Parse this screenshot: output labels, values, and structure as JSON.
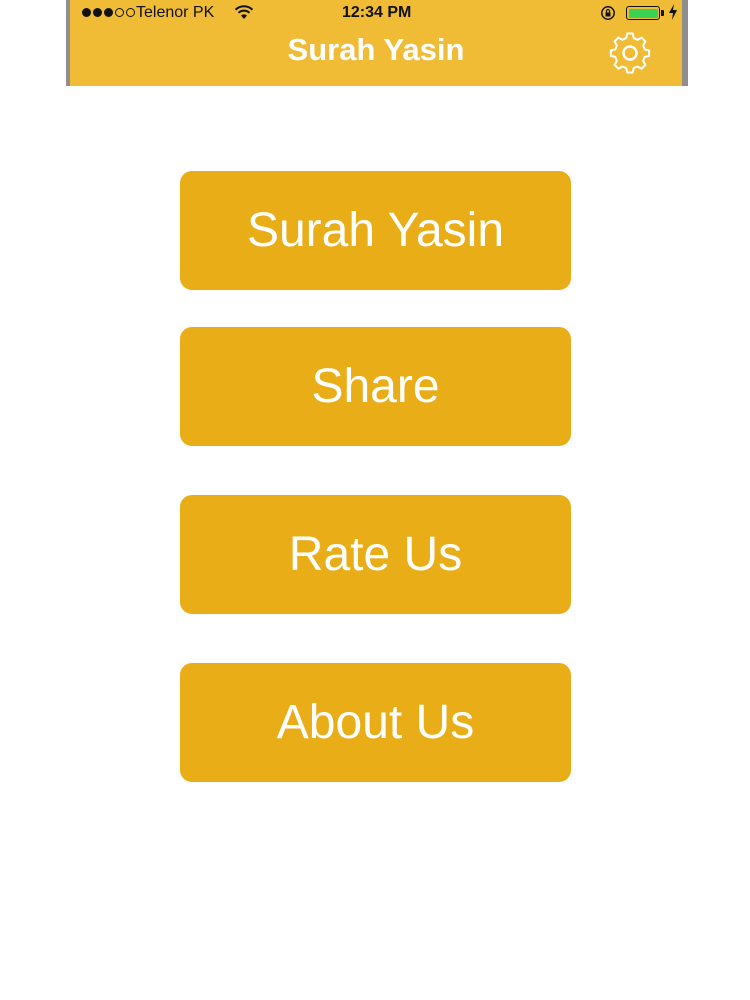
{
  "status_bar": {
    "carrier": "Telenor PK",
    "time": "12:34 PM",
    "signal_bars_filled": 3,
    "signal_bars_total": 5,
    "battery_level": 1.0
  },
  "nav": {
    "title": "Surah Yasin",
    "settings_icon": "gear-icon"
  },
  "menu": {
    "surah_yasin": "Surah Yasin",
    "share": "Share",
    "rate_us": "Rate Us",
    "about_us": "About Us"
  },
  "colors": {
    "nav_background": "#f1bc35",
    "button_background": "#e9ad18",
    "button_text": "#ffffff"
  }
}
